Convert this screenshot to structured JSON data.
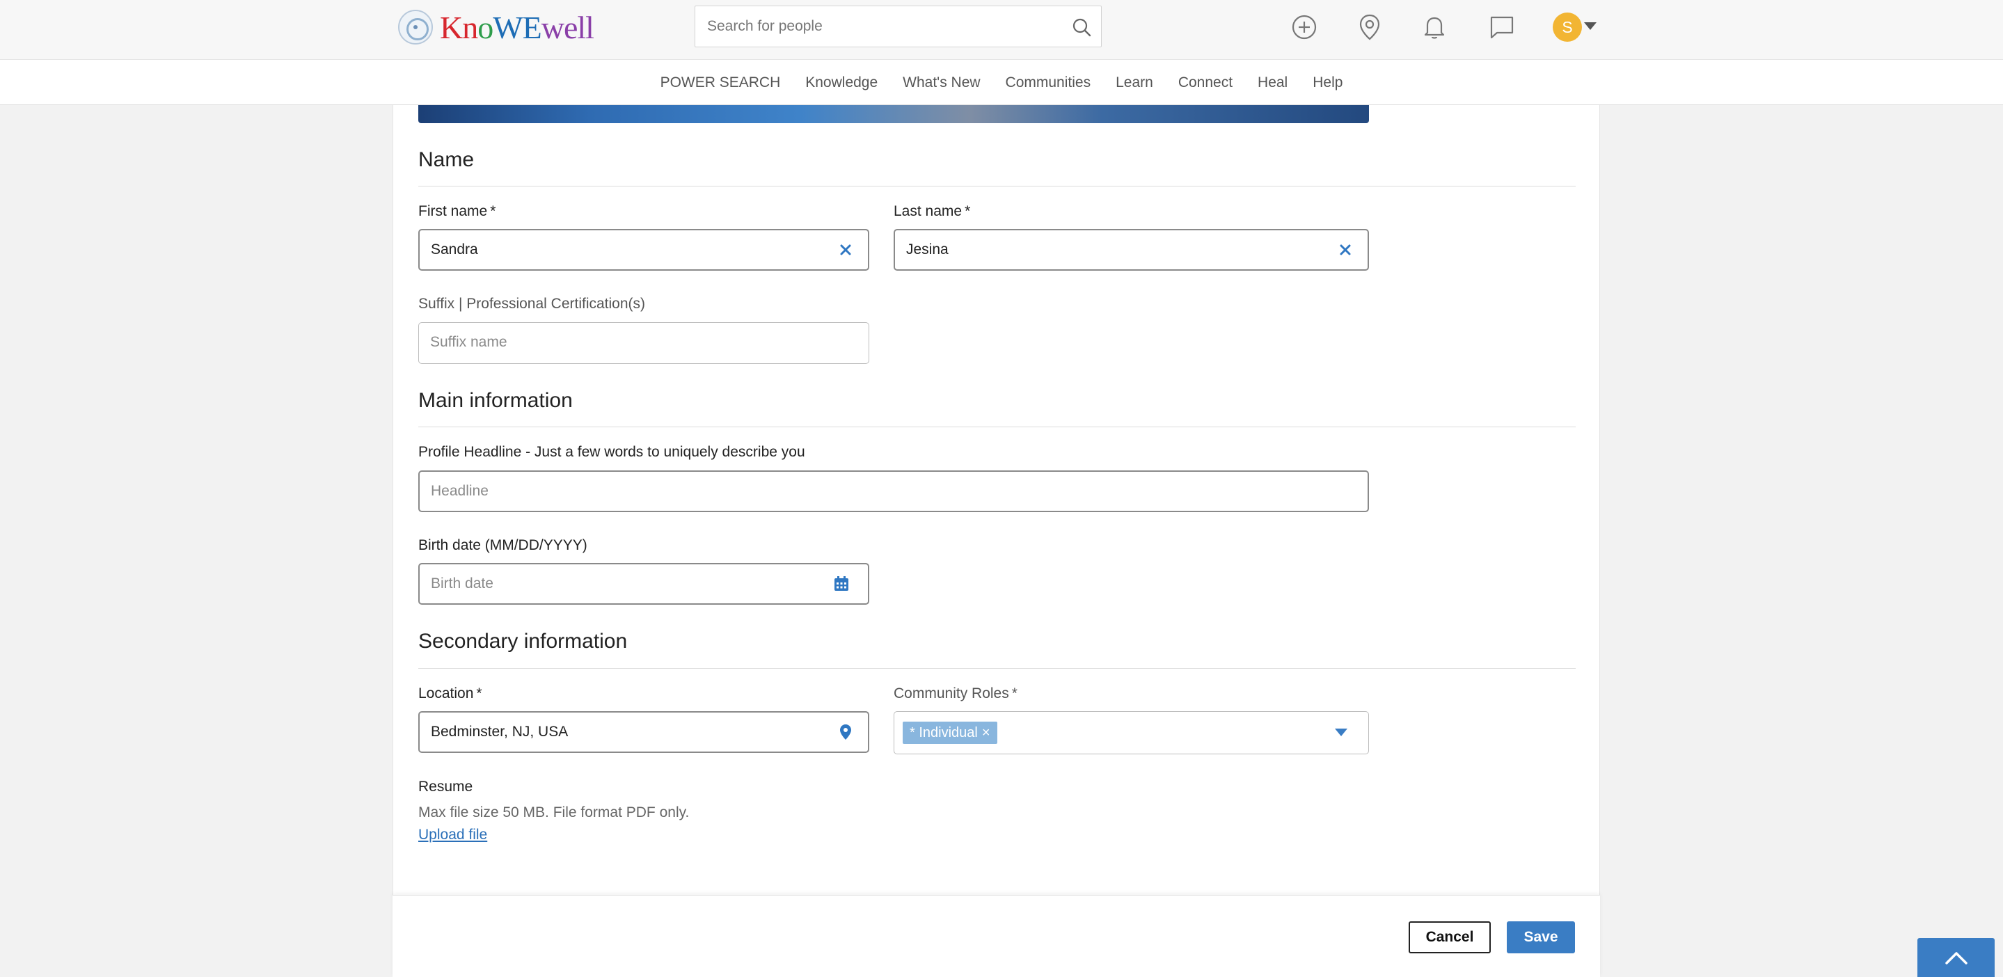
{
  "header": {
    "logo": "KnoWEwell",
    "search_placeholder": "Search for people",
    "avatar_initial": "S"
  },
  "nav": {
    "items": [
      "POWER SEARCH",
      "Knowledge",
      "What's New",
      "Communities",
      "Learn",
      "Connect",
      "Heal",
      "Help"
    ]
  },
  "form": {
    "name_section": {
      "title": "Name",
      "first_name_label": "First name",
      "first_name_value": "Sandra",
      "last_name_label": "Last name",
      "last_name_value": "Jesina",
      "suffix_label": "Suffix | Professional Certification(s)",
      "suffix_placeholder": "Suffix name"
    },
    "main_section": {
      "title": "Main information",
      "headline_label": "Profile Headline - Just a few words to uniquely describe you",
      "headline_placeholder": "Headline",
      "birth_label": "Birth date (MM/DD/YYYY)",
      "birth_placeholder": "Birth date"
    },
    "secondary_section": {
      "title": "Secondary information",
      "location_label": "Location",
      "location_value": "Bedminster, NJ, USA",
      "roles_label": "Community Roles",
      "roles_chip": "* Individual",
      "resume_label": "Resume",
      "resume_hint": "Max file size 50 MB. File format PDF only.",
      "upload_link": "Upload file"
    },
    "required_mark": "*"
  },
  "footer": {
    "cancel_label": "Cancel",
    "save_label": "Save"
  },
  "colors": {
    "accent": "#3a7dc4",
    "avatar": "#f2b533",
    "chip": "#89b6de"
  }
}
